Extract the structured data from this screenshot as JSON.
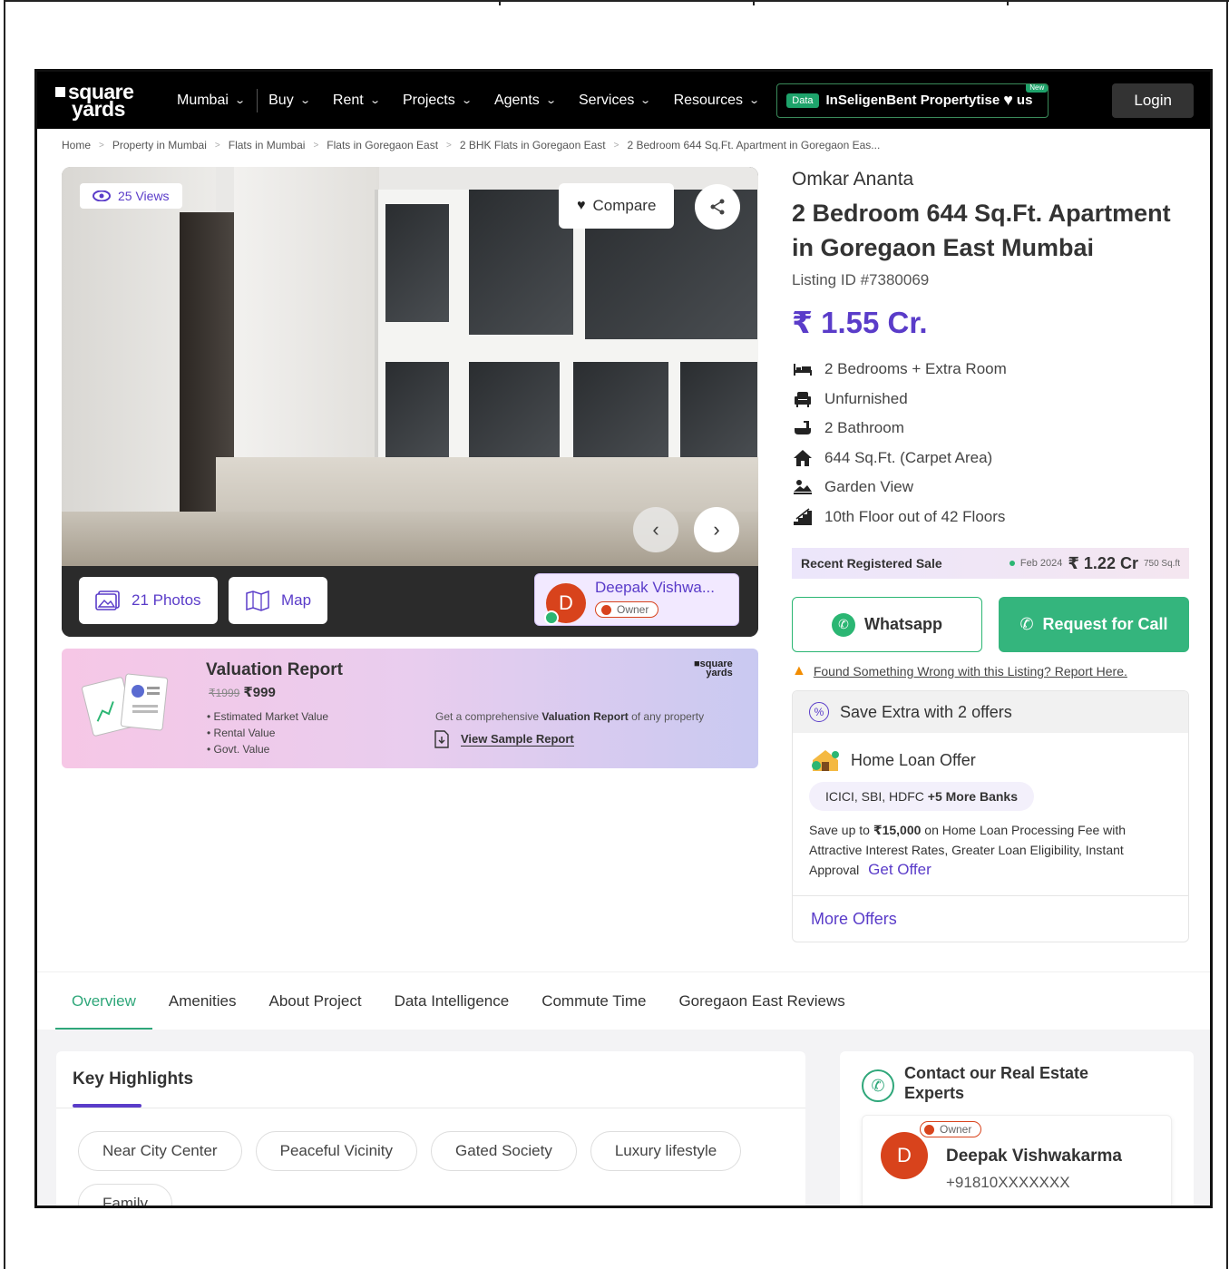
{
  "brand": {
    "line1": "square",
    "line2": "yards"
  },
  "nav": {
    "items": [
      {
        "label": "Mumbai"
      },
      {
        "label": "Buy"
      },
      {
        "label": "Rent"
      },
      {
        "label": "Projects"
      },
      {
        "label": "Agents"
      },
      {
        "label": "Services"
      },
      {
        "label": "Resources"
      }
    ],
    "data_badge": "Data",
    "pill_text": "InSeligenBent Propertytise",
    "pill_tail": "us",
    "new_badge": "New",
    "login": "Login"
  },
  "breadcrumb": [
    "Home",
    "Property in Mumbai",
    "Flats in Mumbai",
    "Flats in Goregaon East",
    "2 BHK Flats in Goregaon East",
    "2 Bedroom 644 Sq.Ft. Apartment in Goregaon Eas..."
  ],
  "gallery": {
    "views": "25 Views",
    "compare": "Compare",
    "photos": "21 Photos",
    "map": "Map",
    "owner_initial": "D",
    "owner_name": "Deepak Vishwa...",
    "owner_tag": "Owner"
  },
  "valuation": {
    "title": "Valuation Report",
    "old_price": "₹1999",
    "price": "₹999",
    "items": [
      "Estimated Market Value",
      "Rental Value",
      "Govt. Value"
    ],
    "logo_line1": "square",
    "logo_line2": "yards",
    "desc_pre": "Get a comprehensive ",
    "desc_bold": "Valuation Report",
    "desc_post": " of any property",
    "link": "View Sample Report"
  },
  "listing": {
    "project": "Omkar Ananta",
    "title": "2 Bedroom 644 Sq.Ft. Apartment in Goregaon East Mumbai",
    "listing_id": "Listing ID #7380069",
    "price": "₹ 1.55 Cr.",
    "features": [
      {
        "icon": "bed-icon",
        "label": "2 Bedrooms + Extra Room"
      },
      {
        "icon": "armchair-icon",
        "label": "Unfurnished"
      },
      {
        "icon": "bathtub-icon",
        "label": "2 Bathroom"
      },
      {
        "icon": "home-icon",
        "label": "644 Sq.Ft. (Carpet Area)"
      },
      {
        "icon": "landscape-icon",
        "label": "Garden View"
      },
      {
        "icon": "stairs-icon",
        "label": "10th Floor out of 42 Floors"
      }
    ],
    "recent_sale": {
      "label": "Recent Registered Sale",
      "date": "Feb 2024",
      "amount": "₹ 1.22 Cr",
      "area": "750 Sq.ft"
    },
    "whatsapp": "Whatsapp",
    "request_call": "Request for Call",
    "report": "Found Something Wrong with this Listing? Report Here."
  },
  "offers": {
    "heading": "Save Extra with 2 offers",
    "title": "Home Loan Offer",
    "banks": "ICICI, SBI, HDFC",
    "banks_more": "+5 More Banks",
    "desc_pre": "Save up to ",
    "desc_amount": "₹15,000",
    "desc_post": " on Home Loan Processing Fee with Attractive Interest Rates, Greater Loan Eligibility, Instant Approval",
    "get_offer": "Get Offer",
    "more": "More Offers"
  },
  "tabs": [
    "Overview",
    "Amenities",
    "About Project",
    "Data Intelligence",
    "Commute Time",
    "Goregaon East Reviews"
  ],
  "highlights": {
    "title": "Key Highlights",
    "chips": [
      "Near City Center",
      "Peaceful Vicinity",
      "Gated Society",
      "Luxury lifestyle",
      "Family"
    ]
  },
  "contact": {
    "title": "Contact our Real Estate Experts",
    "initial": "D",
    "tag": "Owner",
    "name": "Deepak Vishwakarma",
    "phone": "+91810XXXXXXX"
  },
  "colors": {
    "brand_purple": "#5a3cc9",
    "green": "#34b57d",
    "owner_red": "#d8431c"
  }
}
